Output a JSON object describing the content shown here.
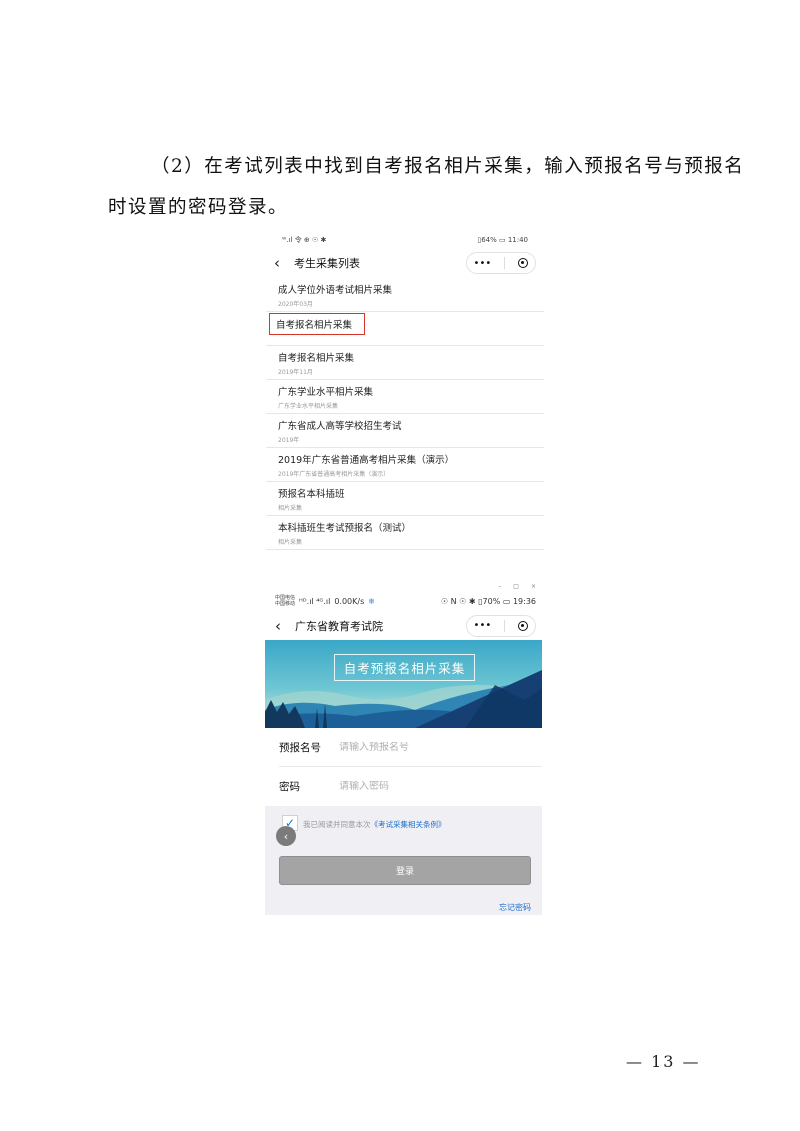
{
  "doc": {
    "line1": "（2）在考试列表中找到自考报名相片采集，输入预报名号与预报名",
    "line2": "时设置的密码登录。",
    "page_number": "— 13 —"
  },
  "shot1": {
    "status_left": "ᵂ.ıl 令 ⊕ ☉ ✱",
    "status_right": "▯64% ▭ 11:40",
    "nav_title": "考生采集列表",
    "items": [
      {
        "title": "成人学位外语考试相片采集",
        "sub": "2020年03月"
      },
      {
        "title": "自考报名相片采集",
        "sub": ""
      },
      {
        "title": "自考报名相片采集",
        "sub": "2019年11月"
      },
      {
        "title": "广东学业水平相片采集",
        "sub": "广东学业水平相片采集"
      },
      {
        "title": "广东省成人高等学校招生考试",
        "sub": "2019年"
      },
      {
        "title": "2019年广东省普通高考相片采集（演示）",
        "sub": "2019年广东省普通高考相片采集（演示）"
      },
      {
        "title": "预报名本科插班",
        "sub": "相片采集"
      },
      {
        "title": "本科插班生考试预报名（测试）",
        "sub": "相片采集"
      }
    ]
  },
  "shot2": {
    "window_controls": [
      "–",
      "□",
      "×"
    ],
    "carrier1": "中国电信",
    "carrier2": "中国移动",
    "speed": "0.00K/s",
    "status_right": "☉ N ☉ ✱ ▯70% ▭ 19:36",
    "nav_title": "广东省教育考试院",
    "banner_title": "自考预报名相片采集",
    "field1_label": "预报名号",
    "field1_placeholder": "请输入预报名号",
    "field2_label": "密码",
    "field2_placeholder": "请输入密码",
    "agree_text": "我已阅读并同意本次",
    "agree_link": "《考试采集相关条例》",
    "login_label": "登录",
    "forgot_label": "忘记密码"
  }
}
